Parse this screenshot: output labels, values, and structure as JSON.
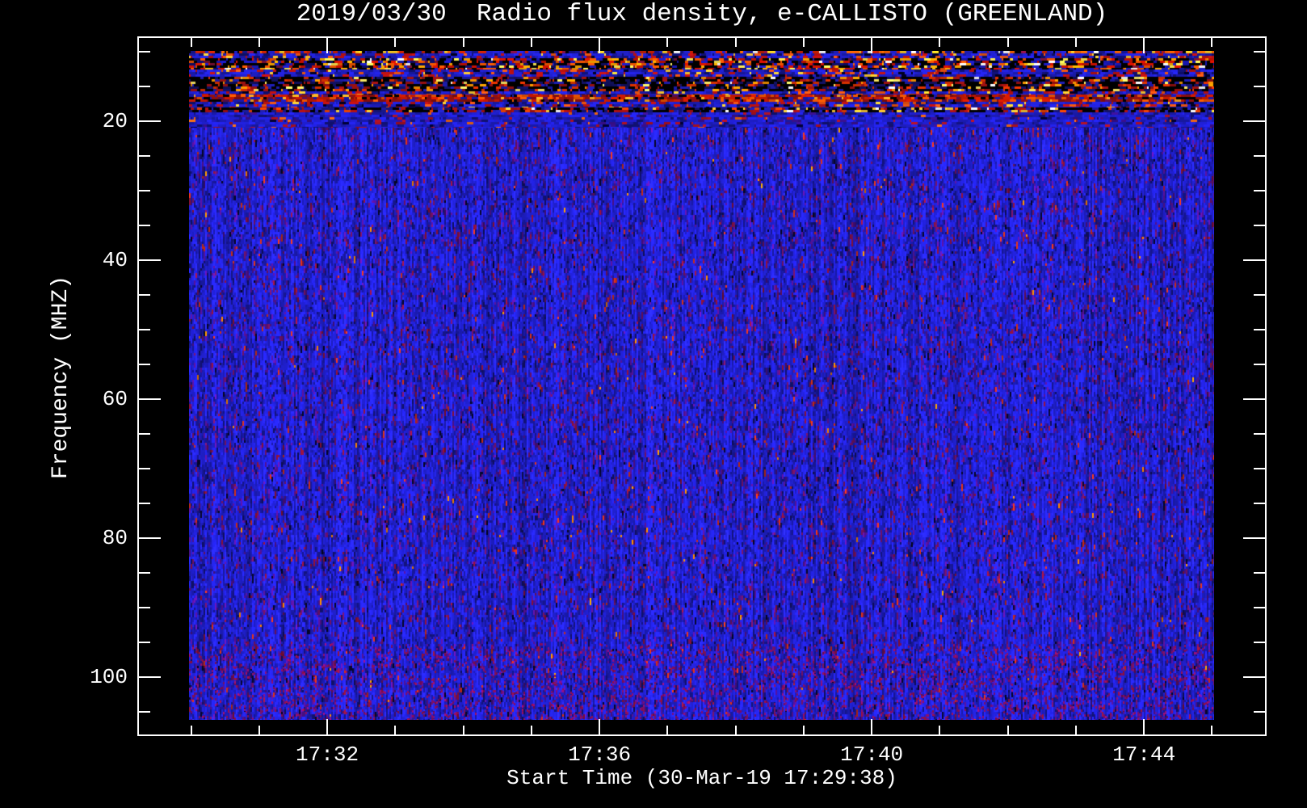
{
  "title": "2019/03/30  Radio flux density, e-CALLISTO (GREENLAND)",
  "colors": {
    "background": "#000000",
    "foreground": "#ffffff",
    "base_noise_blue": "#2222dd"
  },
  "x_axis": {
    "label": "Start Time (30-Mar-19 17:29:38)",
    "start_time": "17:29:38",
    "major_ticks": [
      {
        "label": "17:32",
        "minute": 32
      },
      {
        "label": "17:36",
        "minute": 36
      },
      {
        "label": "17:40",
        "minute": 40
      },
      {
        "label": "17:44",
        "minute": 44
      }
    ],
    "minor_tick_minutes": [
      30,
      31,
      33,
      34,
      35,
      37,
      38,
      39,
      41,
      42,
      43,
      45
    ]
  },
  "y_axis": {
    "label": "Frequency (MHZ)",
    "unit": "MHz",
    "major_ticks": [
      20,
      40,
      60,
      80,
      100
    ],
    "minor_ticks": [
      10,
      15,
      25,
      30,
      35,
      45,
      50,
      55,
      65,
      70,
      75,
      85,
      90,
      95,
      105
    ]
  },
  "chart_data": {
    "type": "heatmap",
    "title": "2019/03/30  Radio flux density, e-CALLISTO (GREENLAND)",
    "xlabel": "Start Time (30-Mar-19 17:29:38)",
    "ylabel": "Frequency (MHZ)",
    "x_range_minutes_after_1700": [
      29.97,
      45.03
    ],
    "y_range_mhz": [
      9.85,
      106.2
    ],
    "y_axis_inverted": true,
    "grid": false,
    "legend": "none",
    "seed": 1337,
    "notes": "Quiet solar radio spectrogram: uniform blue background noise over 21-106 MHz with vertical striations and sparse maroon/purple speckles; strong broadband terrestrial RFI between ~10 and 21 MHz appearing as rows of black/red/orange/yellow/white speckles; no solar burst present.",
    "palettes": {
      "speckle_bright": {
        "orient": "h",
        "colors": [
          [
            "#000000",
            20
          ],
          [
            "#2222cc",
            22
          ],
          [
            "#141488",
            12
          ],
          [
            "#cc2200",
            16
          ],
          [
            "#ff6600",
            12
          ],
          [
            "#ffcc22",
            9
          ],
          [
            "#ffffff",
            4
          ],
          [
            "#881144",
            5
          ]
        ]
      },
      "rfi_mixed": {
        "orient": "h",
        "colors": [
          [
            "#000000",
            30
          ],
          [
            "#1a1abb",
            18
          ],
          [
            "#0d0d66",
            10
          ],
          [
            "#cc1100",
            14
          ],
          [
            "#ee5500",
            10
          ],
          [
            "#ffaa00",
            8
          ],
          [
            "#ffee55",
            6
          ],
          [
            "#ffffff",
            2
          ],
          [
            "#771133",
            2
          ]
        ]
      },
      "rfi_dark": {
        "orient": "h",
        "colors": [
          [
            "#000000",
            42
          ],
          [
            "#11115e",
            16
          ],
          [
            "#1d1dac",
            12
          ],
          [
            "#991111",
            12
          ],
          [
            "#dd3300",
            9
          ],
          [
            "#ff9900",
            5
          ],
          [
            "#ffee66",
            3
          ],
          [
            "#ffffff",
            1
          ]
        ]
      },
      "rfi_dark2": {
        "orient": "h",
        "colors": [
          [
            "#000000",
            34
          ],
          [
            "#16167a",
            18
          ],
          [
            "#2020bb",
            16
          ],
          [
            "#aa1111",
            14
          ],
          [
            "#ee4400",
            10
          ],
          [
            "#ffcc33",
            6
          ],
          [
            "#ffffff",
            2
          ]
        ]
      },
      "blue_speck": {
        "orient": "h",
        "colors": [
          [
            "#2222dd",
            40
          ],
          [
            "#1a1aaa",
            22
          ],
          [
            "#10106e",
            10
          ],
          [
            "#000022",
            6
          ],
          [
            "#bb1111",
            12
          ],
          [
            "#ee5511",
            7
          ],
          [
            "#ffcc33",
            3
          ]
        ]
      },
      "blue_sparse": {
        "orient": "h",
        "colors": [
          [
            "#2121dd",
            48
          ],
          [
            "#1b1bb0",
            26
          ],
          [
            "#121277",
            12
          ],
          [
            "#3a1090",
            6
          ],
          [
            "#aa1122",
            5
          ],
          [
            "#ee6611",
            2
          ],
          [
            "#000033",
            1
          ]
        ]
      },
      "main": {
        "orient": "v",
        "colors": [
          [
            "#2626ee",
            30
          ],
          [
            "#2222dd",
            22
          ],
          [
            "#1e1ec4",
            14
          ],
          [
            "#1a1aa8",
            10
          ],
          [
            "#15158a",
            6
          ],
          [
            "#111168",
            4
          ],
          [
            "#5a12a0",
            5
          ],
          [
            "#44107e",
            3
          ],
          [
            "#6e1260",
            3
          ],
          [
            "#8c1238",
            1.8
          ],
          [
            "#060628",
            1
          ],
          [
            "#d03018",
            0.7
          ],
          [
            "#ff8800",
            0.15
          ]
        ]
      }
    },
    "bands": [
      {
        "f0": 9.85,
        "f1": 10.2,
        "palette": "speckle_bright"
      },
      {
        "f0": 10.2,
        "f1": 10.9,
        "palette": "blue_speck"
      },
      {
        "f0": 10.9,
        "f1": 12.55,
        "palette": "rfi_mixed"
      },
      {
        "f0": 12.55,
        "f1": 13.55,
        "palette": "blue_speck"
      },
      {
        "f0": 13.55,
        "f1": 15.65,
        "palette": "rfi_dark"
      },
      {
        "f0": 15.65,
        "f1": 16.15,
        "palette": "blue_speck"
      },
      {
        "f0": 16.15,
        "f1": 17.2,
        "palette": "red_row"
      },
      {
        "f0": 17.2,
        "f1": 18.0,
        "palette": "blue_speck"
      },
      {
        "f0": 18.0,
        "f1": 18.7,
        "palette": "rfi_dark2"
      },
      {
        "f0": 18.7,
        "f1": 20.9,
        "palette": "blue_sparse"
      },
      {
        "f0": 20.9,
        "f1": 106.2,
        "palette": "main"
      }
    ],
    "red_row_palette": {
      "orient": "h",
      "colors": [
        [
          "#880f0f",
          26
        ],
        [
          "#cc1a00",
          24
        ],
        [
          "#ee5500",
          13
        ],
        [
          "#ffaa22",
          5
        ],
        [
          "#000000",
          12
        ],
        [
          "#1a1ab0",
          14
        ],
        [
          "#5a0f50",
          6
        ]
      ]
    }
  }
}
